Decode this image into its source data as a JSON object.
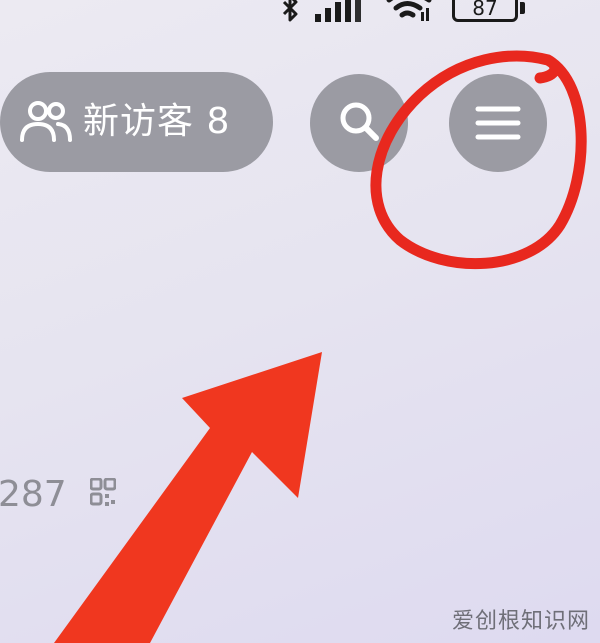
{
  "status_bar": {
    "battery_level": "87",
    "icons": [
      "bluetooth-icon",
      "signal-icon",
      "wifi-icon",
      "battery-icon"
    ]
  },
  "header": {
    "visitors_label": "新访客 8",
    "visitors_icon": "people-icon",
    "search_icon": "search-icon",
    "menu_icon": "hamburger-menu-icon"
  },
  "profile": {
    "account_number_fragment": "287",
    "qr_icon": "qr-code-icon"
  },
  "annotations": {
    "circle_color": "#e8281e",
    "arrow_color": "#f0371f",
    "circle_target": "menu-button",
    "arrow_target": "menu-button"
  },
  "watermark": {
    "text": "爱创根知识网"
  },
  "colors": {
    "button_fill": "#9b9ba3",
    "button_icon": "#ffffff",
    "background": "#e6e4f0"
  }
}
